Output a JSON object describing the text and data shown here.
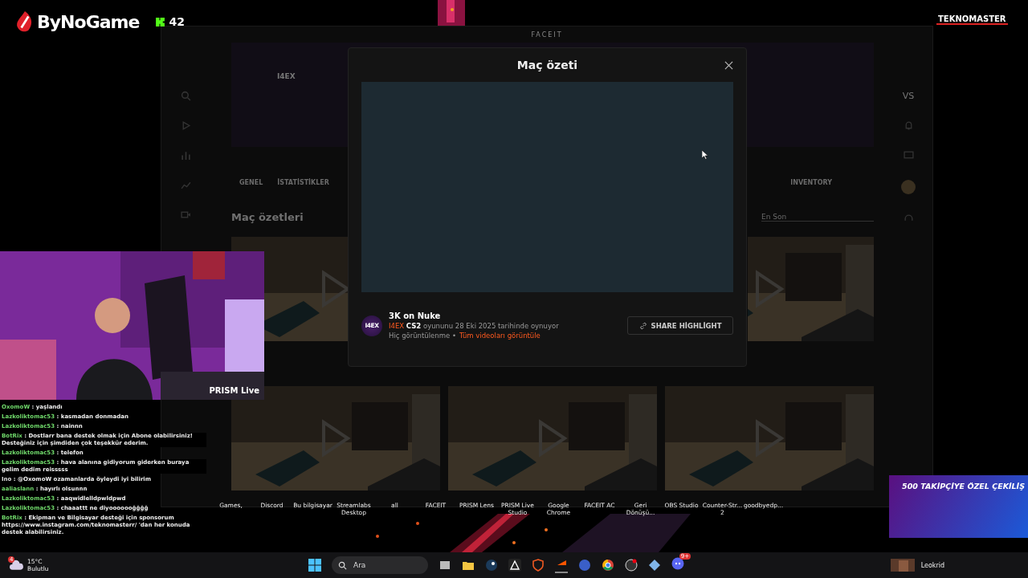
{
  "stream_overlay": {
    "brand": "ByNoGame",
    "kick_count": "42",
    "sponsor": "TEKNOMASTER",
    "webcam_badge": "PRISM Live",
    "giveaway": "500 TAKİPÇİYE ÖZEL ÇEKİLİŞ"
  },
  "app_window": {
    "title": "FACEIT",
    "profile_name": "I4EX",
    "tabs": [
      "GENEL",
      "İSTATİSTİKLER",
      "INVENTORY"
    ],
    "vs_label": "VS",
    "section_title": "Maç özetleri",
    "sort": "En Son"
  },
  "modal": {
    "title": "Maç özeti",
    "clip_title": "3K on Nuke",
    "avatar_text": "I4EX",
    "player": "I4EX",
    "game": "CS2",
    "played_text": "oyununu 28 Eki 2025 tarihinde oynuyor",
    "views": "Hiç görüntülenme •",
    "all_videos_link": "Tüm videoları görüntüle",
    "share_button": "SHARE HİGHLİGHT"
  },
  "chat": [
    {
      "kind": "user",
      "user": "OxomoW",
      "text": ": yaşlandı"
    },
    {
      "kind": "user",
      "user": "Lazkoliktomac53",
      "text": ": kasmadan donmadan"
    },
    {
      "kind": "user",
      "user": "Lazkoliktomac53",
      "text": ": nainnn"
    },
    {
      "kind": "bot",
      "user": "BotRix",
      "text": ": Dostlarr bana destek olmak için Abone olabilirsiniz! Desteğiniz için şimdiden çok teşekkür ederim."
    },
    {
      "kind": "user",
      "user": "Lazkoliktomac53",
      "text": ": telefon"
    },
    {
      "kind": "user",
      "user": "Lazkoliktomac53",
      "text": ": hava alanına gidiyorum giderken buraya gelim dedim reisssss"
    },
    {
      "kind": "plain",
      "user": "Ino",
      "text": ": @OxomoW ozamanlarda öyleydi iyi bilirim"
    },
    {
      "kind": "sub",
      "user": "aaliaslann",
      "text": ": hayırlı olsunnn"
    },
    {
      "kind": "user",
      "user": "Lazkoliktomac53",
      "text": ": aaqwidlelldpwldpwd"
    },
    {
      "kind": "user",
      "user": "Lazkoliktomac53",
      "text": ": chaaattt ne diyooooooğğğğ"
    },
    {
      "kind": "bot",
      "user": "BotRix",
      "text": ": Ekipman ve Bilgisayar desteği için sponsorum https://www.instagram.com/teknomasterr/ 'dan her konuda destek alabilirsiniz."
    }
  ],
  "desktop_icons": [
    "Games,",
    "Discord",
    "Bu bilgisayar",
    "Streamlabs Desktop",
    "all",
    "FACEIT",
    "PRISM Lens",
    "PRISM Live Studio",
    "Google Chrome",
    "FACEIT AC",
    "Geri Dönüşü...",
    "OBS Studio",
    "Counter-Str... 2",
    "goodbyedp..."
  ],
  "taskbar": {
    "weather_badge": "4",
    "temperature": "15°C",
    "condition": "Bulutlu",
    "search_placeholder": "Ara",
    "discord_badge": "9+",
    "user": "Leokrid"
  }
}
